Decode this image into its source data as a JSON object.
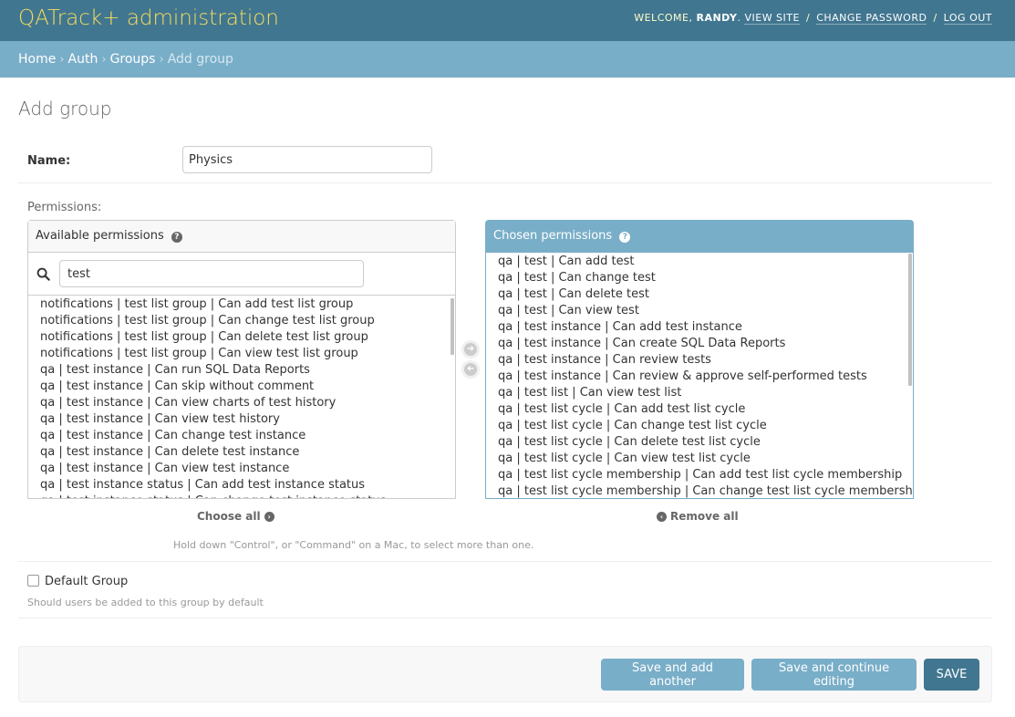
{
  "header": {
    "brand": "QATrack+ administration",
    "welcome": "Welcome,",
    "user_name": "Randy",
    "view_site": "View site",
    "change_password": "Change password",
    "log_out": "Log out"
  },
  "breadcrumbs": {
    "home": "Home",
    "auth": "Auth",
    "groups": "Groups",
    "current": "Add group"
  },
  "page": {
    "title": "Add group"
  },
  "form": {
    "name_label": "Name:",
    "name_value": "Physics",
    "permissions_label": "Permissions:",
    "available": {
      "title": "Available permissions",
      "filter_value": "test",
      "items": [
        "notifications | test list group | Can add test list group",
        "notifications | test list group | Can change test list group",
        "notifications | test list group | Can delete test list group",
        "notifications | test list group | Can view test list group",
        "qa | test instance | Can run SQL Data Reports",
        "qa | test instance | Can skip without comment",
        "qa | test instance | Can view charts of test history",
        "qa | test instance | Can view test history",
        "qa | test instance | Can change test instance",
        "qa | test instance | Can delete test instance",
        "qa | test instance | Can view test instance",
        "qa | test instance status | Can add test instance status",
        "qa | test instance status | Can change test instance status"
      ]
    },
    "chosen": {
      "title": "Chosen permissions",
      "items": [
        "qa | test | Can add test",
        "qa | test | Can change test",
        "qa | test | Can delete test",
        "qa | test | Can view test",
        "qa | test instance | Can add test instance",
        "qa | test instance | Can create SQL Data Reports",
        "qa | test instance | Can review tests",
        "qa | test instance | Can review & approve self-performed tests",
        "qa | test list | Can view test list",
        "qa | test list cycle | Can add test list cycle",
        "qa | test list cycle | Can change test list cycle",
        "qa | test list cycle | Can delete test list cycle",
        "qa | test list cycle | Can view test list cycle",
        "qa | test list cycle membership | Can add test list cycle membership",
        "qa | test list cycle membership | Can change test list cycle membership"
      ]
    },
    "choose_all": "Choose all",
    "remove_all": "Remove all",
    "help_text": "Hold down \"Control\", or \"Command\" on a Mac, to select more than one.",
    "default_group_label": "Default Group",
    "default_group_help": "Should users be added to this group by default"
  },
  "buttons": {
    "save_add_another": "Save and add another",
    "save_continue": "Save and continue editing",
    "save": "SAVE"
  },
  "colors": {
    "header_bg": "#417690",
    "brand": "#f5dd5d",
    "breadcrumb_bg": "#79aec8",
    "button_light": "#79aec8",
    "button_dark": "#417690"
  }
}
